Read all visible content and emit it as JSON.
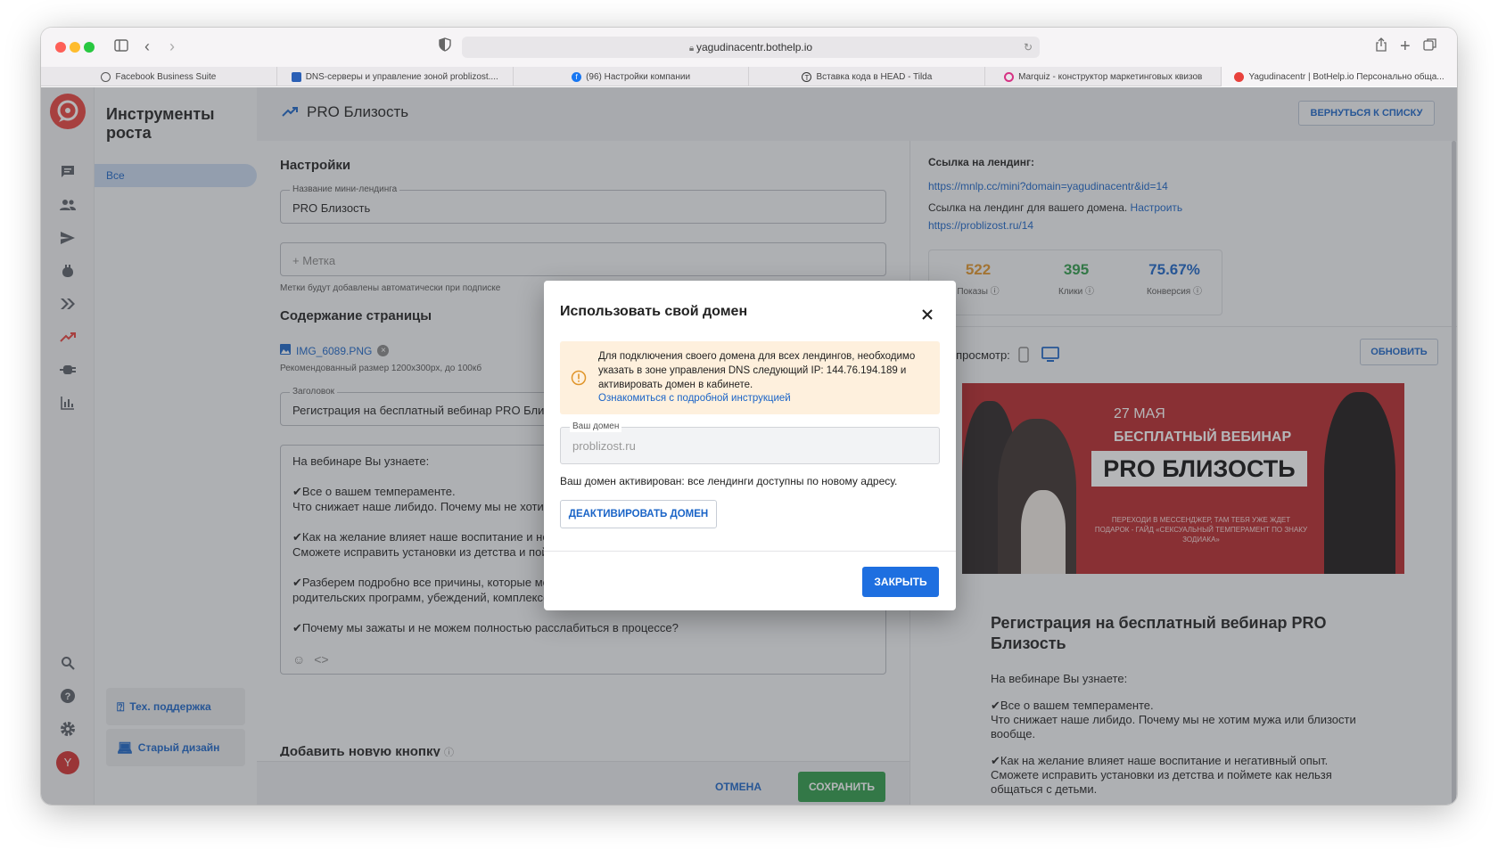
{
  "browser": {
    "url": "yagudinacentr.bothelp.io",
    "tabs": [
      {
        "label": "Facebook Business Suite",
        "color": "#555555"
      },
      {
        "label": "DNS-серверы и управление зоной problizost....",
        "color": "#2a5fb5"
      },
      {
        "label": "(96) Настройки компании",
        "color": "#1877f2"
      },
      {
        "label": "Вставка кода в HEAD - Tilda",
        "color": "#333333"
      },
      {
        "label": "Marquiz - конструктор маркетинговых квизов",
        "color": "#d63384"
      },
      {
        "label": "Yagudinacentr | BotHelp.io Персонально обща...",
        "color": "#e8413c"
      }
    ]
  },
  "sidebar": {
    "title": "Инструменты роста",
    "active_item": "Все",
    "support_label": "Тех. поддержка",
    "old_design_label": "Старый дизайн",
    "avatar_letter": "Y"
  },
  "header": {
    "title": "PRO Близость",
    "back_button": "ВЕРНУТЬСЯ К СПИСКУ"
  },
  "form": {
    "settings_heading": "Настройки",
    "name_label": "Название мини-лендинга",
    "name_value": "PRO Близость",
    "tag_placeholder": "+ Метка",
    "tag_hint": "Метки будут добавлены автоматически при подписке",
    "content_heading": "Содержание страницы",
    "file_name": "IMG_6089.PNG",
    "file_hint": "Рекомендованный размер 1200x300px, до 100кб",
    "title_label": "Заголовок",
    "title_value": "Регистрация на бесплатный вебинар PRO Близость",
    "editor_lines": [
      "На вебинаре Вы узнаете:",
      "",
      "✔Все о вашем темпераменте.",
      "Что снижает наше либидо. Почему мы не хотим мужа или близости вообще.",
      "",
      "✔Как на желание влияет наше воспитание и негативный опыт.",
      "Сможете исправить установки из детства и поймете как нельзя общаться с детьми.",
      "",
      "✔Разберем подробно все причины, которые мешают вам получать удовольствие: от",
      "родительских программ, убеждений, комплексов.",
      "",
      "✔Почему мы зажаты и не можем полностью расслабиться в процессе?"
    ],
    "add_button_heading": "Добавить новую кнопку",
    "cancel_label": "ОТМЕНА",
    "save_label": "СОХРАНИТЬ"
  },
  "preview": {
    "landing_link_label": "Ссылка на лендинг:",
    "landing_link": "https://mnlp.cc/mini?domain=yagudinacentr&id=14",
    "domain_link_text": "Ссылка на лендинг для вашего домена.",
    "configure_link": "Настроить",
    "domain_link": "https://problizost.ru/14",
    "stats": [
      {
        "value": "522",
        "label": "Показы",
        "color": "#e0952a"
      },
      {
        "value": "395",
        "label": "Клики",
        "color": "#2e9b4a"
      },
      {
        "value": "75.67%",
        "label": "Конверсия",
        "color": "#1a64c7"
      }
    ],
    "preview_label": "Предпросмотр:",
    "refresh_label": "ОБНОВИТЬ",
    "banner": {
      "date": "27 МАЯ",
      "free_webinar": "БЕСПЛАТНЫЙ ВЕБИНАР",
      "pro": "PRO БЛИЗОСТЬ",
      "small": "ПЕРЕХОДИ В МЕССЕНДЖЕР, ТАМ ТЕБЯ УЖЕ ЖДЕТ ПОДАРОК - ГАЙД «СЕКСУАЛЬНЫЙ ТЕМПЕРАМЕНТ ПО ЗНАКУ ЗОДИАКА»"
    },
    "heading": "Регистрация на бесплатный вебинар PRO Близость",
    "p1": "На вебинаре Вы узнаете:",
    "p2a": "✔Все о вашем темпераменте.",
    "p2b": "Что снижает наше либидо. Почему мы не хотим мужа или близости вообще.",
    "p3a": "✔Как на желание влияет наше воспитание и негативный опыт.",
    "p3b": "Сможете исправить установки из детства и поймете как нельзя общаться с детьми."
  },
  "modal": {
    "title": "Использовать свой домен",
    "alert_text": "Для подключения своего домена для всех лендингов, необходимо указать в зоне управления DNS следующий IP: 144.76.194.189 и активировать домен в кабинете.",
    "alert_link": "Ознакомиться с подробной инструкцией",
    "domain_label": "Ваш домен",
    "domain_value": "problizost.ru",
    "activated_text": "Ваш домен активирован: все лендинги доступны по новому адресу.",
    "deactivate_label": "ДЕАКТИВИРОВАТЬ ДОМЕН",
    "close_label": "ЗАКРЫТЬ"
  }
}
